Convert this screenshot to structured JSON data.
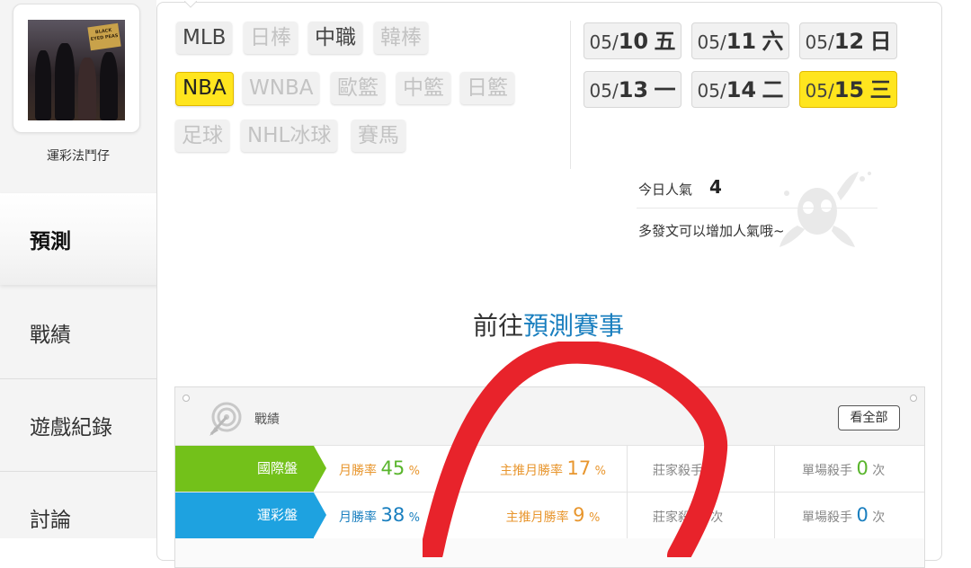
{
  "sidebar": {
    "username": "運彩法鬥仔",
    "avatar_logo_text": "BLACK EYED PEAS",
    "nav": [
      {
        "label": "預測",
        "active": true
      },
      {
        "label": "戰績",
        "active": false
      },
      {
        "label": "遊戲紀錄",
        "active": false
      },
      {
        "label": "討論",
        "active": false
      }
    ]
  },
  "leagues": [
    {
      "label": "MLB",
      "state": "enabled"
    },
    {
      "label": "日棒",
      "state": "disabled"
    },
    {
      "label": "中職",
      "state": "enabled"
    },
    {
      "label": "韓棒",
      "state": "disabled"
    },
    {
      "label": "NBA",
      "state": "active"
    },
    {
      "label": "WNBA",
      "state": "disabled"
    },
    {
      "label": "歐籃",
      "state": "disabled"
    },
    {
      "label": "中籃",
      "state": "disabled"
    },
    {
      "label": "日籃",
      "state": "disabled"
    },
    {
      "label": "足球",
      "state": "disabled"
    },
    {
      "label": "NHL冰球",
      "state": "disabled"
    },
    {
      "label": "賽馬",
      "state": "disabled"
    }
  ],
  "dates": [
    {
      "month": "05/",
      "day": "10",
      "weekday": "五",
      "active": false
    },
    {
      "month": "05/",
      "day": "11",
      "weekday": "六",
      "active": false
    },
    {
      "month": "05/",
      "day": "12",
      "weekday": "日",
      "active": false
    },
    {
      "month": "05/",
      "day": "13",
      "weekday": "一",
      "active": false
    },
    {
      "month": "05/",
      "day": "14",
      "weekday": "二",
      "active": false
    },
    {
      "month": "05/",
      "day": "15",
      "weekday": "三",
      "active": true
    }
  ],
  "popularity": {
    "label": "今日人氣",
    "value": "4",
    "tip": "多發文可以增加人氣哦~"
  },
  "cta": {
    "prefix": "前往",
    "link": "預測賽事"
  },
  "record": {
    "title": "戰績",
    "view_all": "看全部",
    "rows": [
      {
        "label": "國際盤",
        "month_label": "月勝率",
        "month_value": "45",
        "month_unit": "%",
        "main_label": "主推月勝率",
        "main_value": "17",
        "main_unit": "%",
        "dealer_label": "莊家殺手",
        "dealer_value": "",
        "dealer_unit": "次",
        "single_label": "單場殺手",
        "single_value": "0",
        "single_unit": "次"
      },
      {
        "label": "運彩盤",
        "month_label": "月勝率",
        "month_value": "38",
        "month_unit": "%",
        "main_label": "主推月勝率",
        "main_value": "9",
        "main_unit": "%",
        "dealer_label": "莊家殺",
        "dealer_value": "1",
        "dealer_unit": "次",
        "single_label": "單場殺手",
        "single_value": "0",
        "single_unit": "次"
      }
    ]
  },
  "colors": {
    "accent_yellow": "#ffe51e",
    "link_blue": "#1a7fbf",
    "row_green": "#73c11a",
    "row_blue": "#1ea2e0",
    "annotation_red": "#e8232b"
  }
}
